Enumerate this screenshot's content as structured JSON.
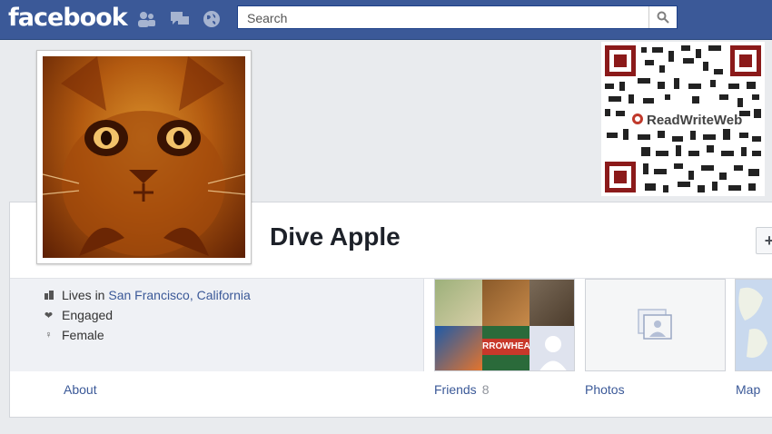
{
  "topbar": {
    "logo": "facebook",
    "icons": [
      "friend-requests-icon",
      "messages-icon",
      "notifications-globe-icon"
    ],
    "search_placeholder": "Search",
    "search_icon": "magnifier-icon",
    "color": "#3b5998"
  },
  "cover": {
    "qr_label": "ReadWriteWeb"
  },
  "profile": {
    "name": "Dive Apple"
  },
  "info": {
    "lives_in_prefix": "Lives in",
    "lives_in_location": "San Francisco, California",
    "relationship": "Engaged",
    "gender": "Female"
  },
  "tabs": {
    "about": "About",
    "friends": "Friends",
    "friends_count": "8",
    "photos": "Photos",
    "map": "Map"
  },
  "friends_tile": {
    "banner_text": "RROWHEA"
  },
  "colors": {
    "link": "#3b5998",
    "panel_bg": "#ffffff",
    "info_bg": "#eff1f5"
  }
}
